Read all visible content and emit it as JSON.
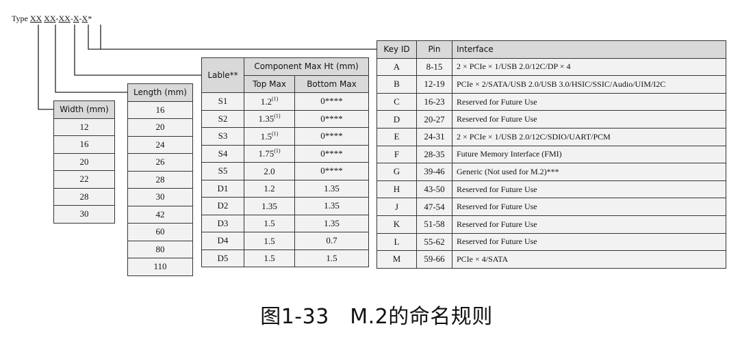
{
  "type_label": {
    "prefix": "Type",
    "segments": [
      "XX",
      "XX",
      "XX",
      "X",
      "X"
    ],
    "separators": [
      " ",
      "-",
      "-",
      "-"
    ],
    "suffix": "*"
  },
  "width_table": {
    "header": "Width (mm)",
    "rows": [
      "12",
      "16",
      "20",
      "22",
      "28",
      "30"
    ]
  },
  "length_table": {
    "header": "Length (mm)",
    "rows": [
      "16",
      "20",
      "24",
      "26",
      "28",
      "30",
      "42",
      "60",
      "80",
      "110"
    ]
  },
  "component_table": {
    "label_header": "Lable**",
    "group_header": "Component Max Ht (mm)",
    "top_header": "Top Max",
    "bottom_header": "Bottom Max",
    "rows": [
      {
        "label": "S1",
        "top": "1.2",
        "top_note": "(1)",
        "bottom": "0****"
      },
      {
        "label": "S2",
        "top": "1.35",
        "top_note": "(1)",
        "bottom": "0****"
      },
      {
        "label": "S3",
        "top": "1.5",
        "top_note": "(1)",
        "bottom": "0****"
      },
      {
        "label": "S4",
        "top": "1.75",
        "top_note": "(1)",
        "bottom": "0****"
      },
      {
        "label": "S5",
        "top": "2.0",
        "top_note": "",
        "bottom": "0****"
      },
      {
        "label": "D1",
        "top": "1.2",
        "top_note": "",
        "bottom": "1.35"
      },
      {
        "label": "D2",
        "top": "1.35",
        "top_note": "",
        "bottom": "1.35"
      },
      {
        "label": "D3",
        "top": "1.5",
        "top_note": "",
        "bottom": "1.35"
      },
      {
        "label": "D4",
        "top": "1.5",
        "top_note": "",
        "bottom": "0.7"
      },
      {
        "label": "D5",
        "top": "1.5",
        "top_note": "",
        "bottom": "1.5"
      }
    ]
  },
  "key_table": {
    "headers": {
      "key": "Key ID",
      "pin": "Pin",
      "interface": "Interface"
    },
    "rows": [
      {
        "key": "A",
        "pin": "8-15",
        "interface": "2 × PCIe × 1/USB 2.0/12C/DP × 4"
      },
      {
        "key": "B",
        "pin": "12-19",
        "interface": "PCIe × 2/SATA/USB 2.0/USB 3.0/HSIC/SSIC/Audio/UIM/I2C"
      },
      {
        "key": "C",
        "pin": "16-23",
        "interface": "Reserved for Future Use"
      },
      {
        "key": "D",
        "pin": "20-27",
        "interface": "Reserved for Future Use"
      },
      {
        "key": "E",
        "pin": "24-31",
        "interface": "2 × PCIe × 1/USB 2.0/12C/SDIO/UART/PCM"
      },
      {
        "key": "F",
        "pin": "28-35",
        "interface": "Future Memory Interface (FMI)"
      },
      {
        "key": "G",
        "pin": "39-46",
        "interface": "Generic (Not used for M.2)***"
      },
      {
        "key": "H",
        "pin": "43-50",
        "interface": "Reserved for Future Use"
      },
      {
        "key": "J",
        "pin": "47-54",
        "interface": "Reserved for Future Use"
      },
      {
        "key": "K",
        "pin": "51-58",
        "interface": "Reserved for Future Use"
      },
      {
        "key": "L",
        "pin": "55-62",
        "interface": "Reserved for Future Use"
      },
      {
        "key": "M",
        "pin": "59-66",
        "interface": "PCIe × 4/SATA"
      }
    ]
  },
  "caption": "图1-33　M.2的命名规则"
}
